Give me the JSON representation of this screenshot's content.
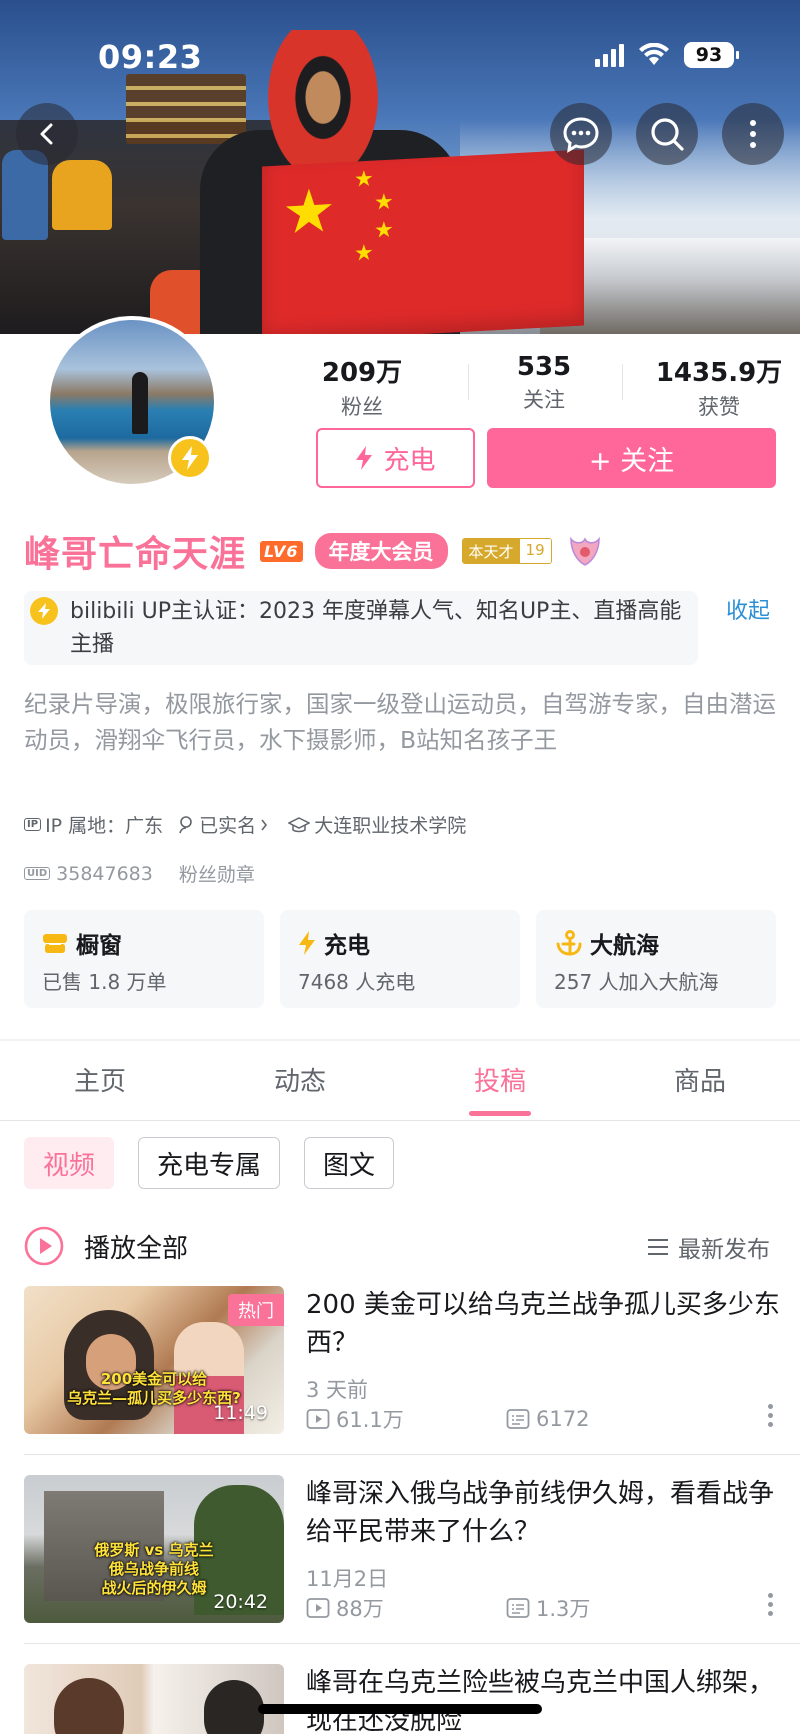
{
  "status_bar": {
    "time": "09:23",
    "battery": "93"
  },
  "profile": {
    "stats": [
      {
        "value": "209万",
        "label": "粉丝"
      },
      {
        "value": "535",
        "label": "关注"
      },
      {
        "value": "1435.9万",
        "label": "获赞"
      }
    ],
    "charge_button": "充电",
    "follow_button": "+ 关注",
    "username": "峰哥亡命天涯",
    "level": "LV6",
    "vip_badge": "年度大会员",
    "medal": {
      "name": "本天才",
      "level": "19"
    },
    "verify_text": "bilibili UP主认证：2023 年度弹幕人气、知名UP主、直播高能主播",
    "collapse_label": "收起",
    "bio": "纪录片导演，极限旅行家，国家一级登山运动员，自驾游专家，自由潜运动员，滑翔伞飞行员，水下摄影师，B站知名孩子王",
    "ip_tag": "IP",
    "ip_location": "IP 属地：广东",
    "real_name": "已实名",
    "school": "大连职业技术学院",
    "uid_tag": "UID",
    "uid": "35847683",
    "fan_medal": "粉丝勋章"
  },
  "cards": [
    {
      "title": "橱窗",
      "subtitle": "已售 1.8 万单",
      "icon": "shop-icon"
    },
    {
      "title": "充电",
      "subtitle": "7468 人充电",
      "icon": "lightning-icon"
    },
    {
      "title": "大航海",
      "subtitle": "257 人加入大航海",
      "icon": "anchor-icon"
    }
  ],
  "tabs": [
    {
      "label": "主页"
    },
    {
      "label": "动态"
    },
    {
      "label": "投稿",
      "active": true
    },
    {
      "label": "商品"
    }
  ],
  "chips": [
    {
      "label": "视频",
      "active": true
    },
    {
      "label": "充电专属"
    },
    {
      "label": "图文"
    }
  ],
  "list_header": {
    "play_all": "播放全部",
    "sort": "最新发布"
  },
  "videos": [
    {
      "title": "200 美金可以给乌克兰战争孤儿买多少东西？",
      "date": "3 天前",
      "views": "61.1万",
      "comments": "6172",
      "duration": "11:49",
      "badge": "热门",
      "thumb_caption_1": "200美金可以给",
      "thumb_caption_2": "乌克兰—孤儿买多少东西?"
    },
    {
      "title": "峰哥深入俄乌战争前线伊久姆，看看战争给平民带来了什么？",
      "date": "11月2日",
      "views": "88万",
      "comments": "1.3万",
      "duration": "20:42",
      "thumb_caption_1": "俄罗斯 vs 乌克兰",
      "thumb_caption_2": "俄乌战争前线",
      "thumb_caption_3": "战火后的伊久姆"
    },
    {
      "title": "峰哥在乌克兰险些被乌克兰中国人绑架，现在还没脱险"
    }
  ],
  "colors": {
    "accent": "#fb7299",
    "link": "#2b8fd6",
    "gold": "#f8c21d"
  }
}
